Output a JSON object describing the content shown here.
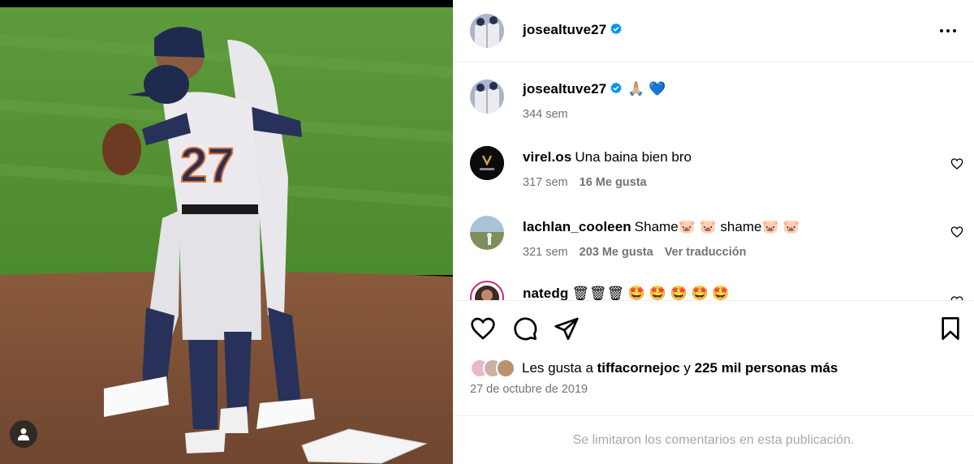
{
  "post": {
    "author": {
      "username": "josealtuve27",
      "verified": true,
      "avatar": "avatar-photo"
    },
    "caption": {
      "username": "josealtuve27",
      "emojis": "🙏🏼 💙",
      "time": "344 sem"
    },
    "comments": [
      {
        "username": "virel.os",
        "text": "Una baina bien bro",
        "time": "317 sem",
        "likes": "16 Me gusta",
        "translate": "",
        "avatar": "virel-logo"
      },
      {
        "username": "lachlan_cooleen",
        "text": "Shame🐷 🐷 shame🐷 🐷",
        "time": "321 sem",
        "likes": "203 Me gusta",
        "translate": "Ver traducción",
        "avatar": "landscape-photo"
      },
      {
        "username": "natedg",
        "text": "🗑🗑🗑 🤩 🤩 🤩 🤩 🤩",
        "time": "",
        "likes": "",
        "translate": "",
        "avatar": "story-ring-avatar"
      }
    ],
    "likes": {
      "prefix": "Les gusta a",
      "user": "tiffacornejoc",
      "connector": "y",
      "others": "225 mil personas más"
    },
    "date": "27 de octubre de 2019",
    "comments_limited": "Se limitaron los comentarios en esta publicación.",
    "colors": {
      "verified": "#0095f6",
      "meta_gray": "#737373",
      "divider": "#efefef",
      "limited_text": "#a8a8a8"
    },
    "icons": [
      "heart-icon",
      "comment-icon",
      "share-icon",
      "bookmark-icon",
      "more-icon",
      "tagged-user-icon",
      "verified-icon"
    ]
  }
}
